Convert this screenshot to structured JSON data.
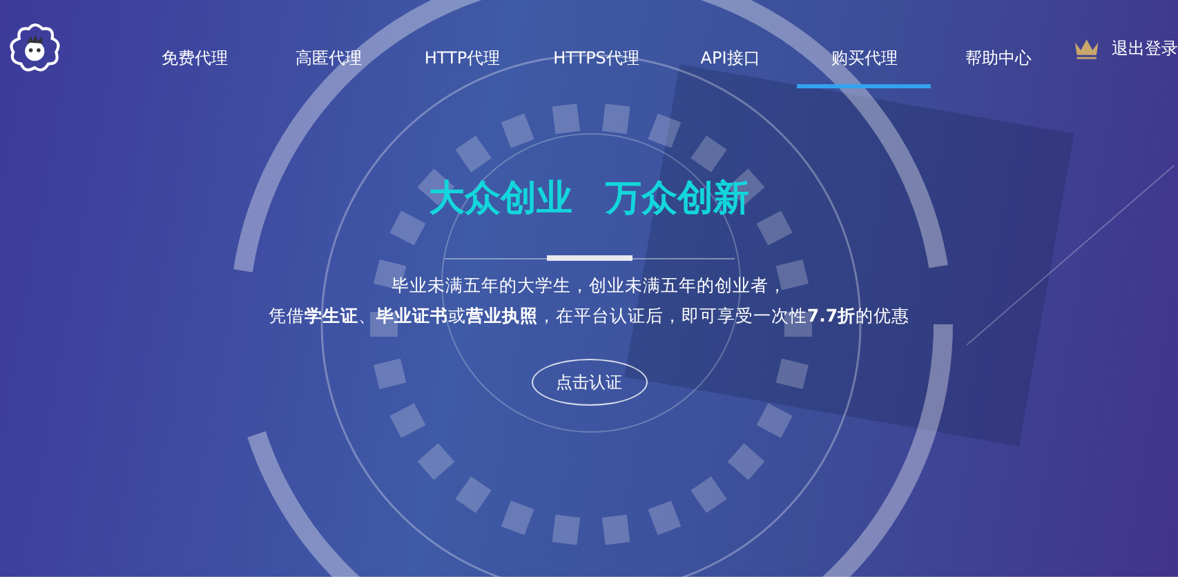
{
  "nav": {
    "items": [
      {
        "label": "免费代理",
        "selected": false
      },
      {
        "label": "高匿代理",
        "selected": false
      },
      {
        "label": "HTTP代理",
        "selected": false
      },
      {
        "label": "HTTPS代理",
        "selected": false
      },
      {
        "label": "API接口",
        "selected": false
      },
      {
        "label": "购买代理",
        "selected": true
      },
      {
        "label": "帮助中心",
        "selected": false
      }
    ],
    "logout": "退出登录"
  },
  "hero": {
    "title_left": "大众创业",
    "title_right": "万众创新",
    "line_1": "毕业未满五年的大学生，创业未满五年的创业者，",
    "line_2": "凭借**学生证**、**毕业证书**或**营业执照**，在平台认证后，即可享受一次性**7.7折**的优惠",
    "button": "点击认证"
  }
}
